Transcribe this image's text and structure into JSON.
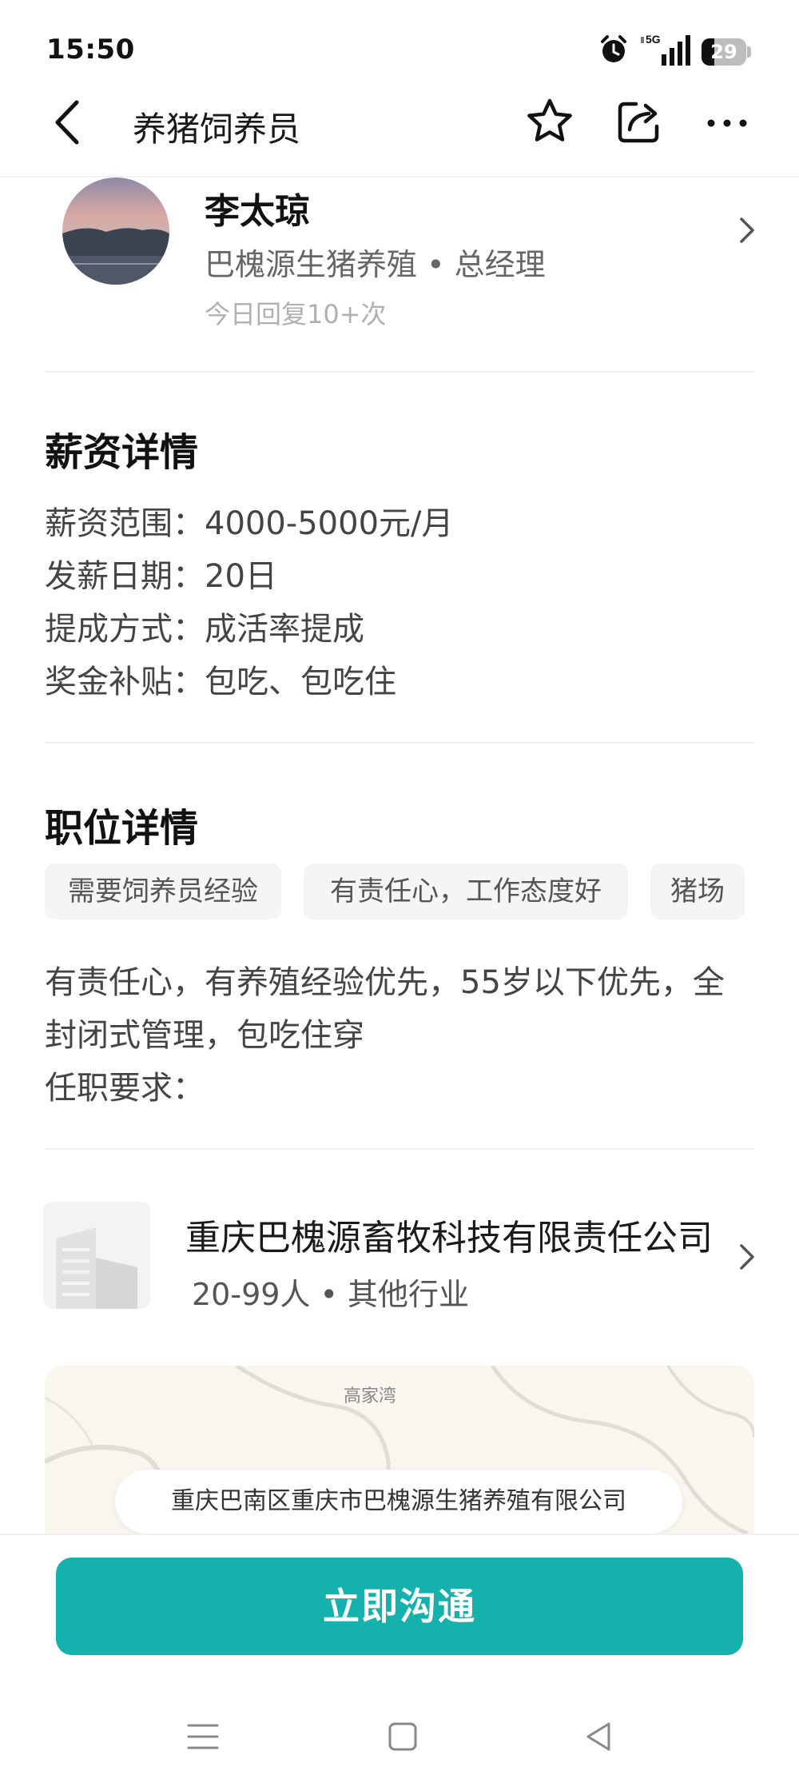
{
  "status_bar": {
    "time": "15:50",
    "network": "5G",
    "battery_level": "29",
    "icons": [
      "alarm-icon",
      "signal-icon",
      "battery-icon"
    ]
  },
  "nav": {
    "title": "养猪饲养员",
    "icons": [
      "back-arrow-icon",
      "star-icon",
      "share-icon",
      "more-dots-icon"
    ]
  },
  "recruiter": {
    "name": "李太琼",
    "company_title": "巴槐源生猪养殖 • 总经理",
    "reply_info": "今日回复10+次"
  },
  "salary": {
    "title": "薪资详情",
    "rows": [
      "薪资范围：4000-5000元/月",
      "发薪日期：20日",
      "提成方式：成活率提成",
      "奖金补贴：包吃、包吃住"
    ]
  },
  "position": {
    "title": "职位详情",
    "tags": [
      "需要饲养员经验",
      "有责任心，工作态度好",
      "猪场"
    ],
    "description_lines": [
      "有责任心，有养殖经验优先，55岁以下优先，全",
      "封闭式管理，包吃住穿",
      "任职要求："
    ]
  },
  "company": {
    "name": "重庆巴槐源畜牧科技有限责任公司",
    "meta": "20-99人 • 其他行业"
  },
  "map": {
    "place_label": "高家湾",
    "address": "重庆巴南区重庆市巴槐源生猪养殖有限公司"
  },
  "action": {
    "chat_label": "立即沟通"
  },
  "theme": {
    "accent": "#15b1ad"
  }
}
